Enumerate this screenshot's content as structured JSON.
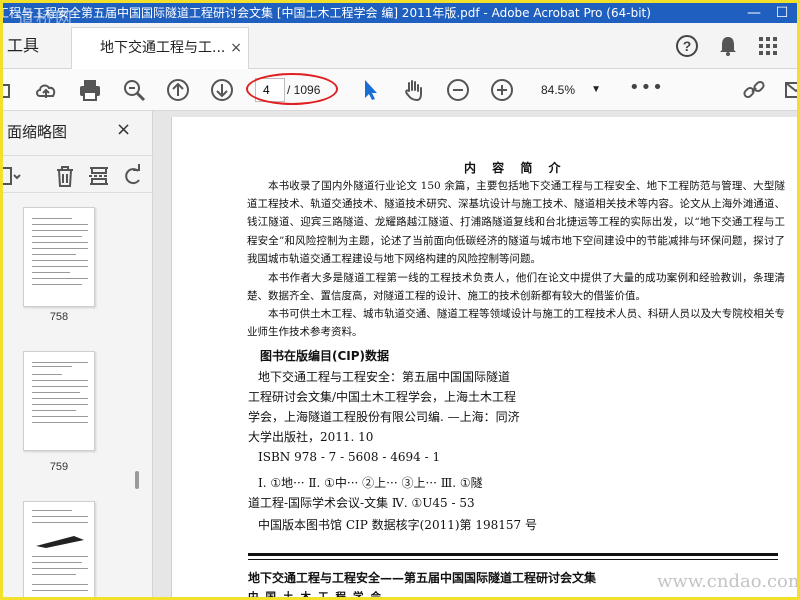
{
  "window": {
    "title": "工程与工程安全第五届中国国际隧道工程研讨会文集 [中国土木工程学会 编] 2011年版.pdf - Adobe Acrobat Pro (64-bit)",
    "watermark_top": "道桥网",
    "min_btn": "—",
    "max_btn": "☐"
  },
  "tabs": {
    "tools_label": "工具",
    "doc_tab_label": "地下交通工程与工...",
    "doc_tab_close": "×"
  },
  "toolbar": {
    "current_page": "4",
    "total_pages": "/ 1096",
    "zoom": "84.5%",
    "more": "•••"
  },
  "sidepanel": {
    "title": "面缩略图",
    "close": "×",
    "thumbnails": [
      "758",
      "759"
    ]
  },
  "page": {
    "heading": "内 容 简 介",
    "para1": "本书收录了国内外隧道行业论文 150 余篇，主要包括地下交通工程与工程安全、地下工程防范与管理、大型隧道工程技术、轨道交通技术、隧道技术研究、深基坑设计与施工技术、隧道相关技术等内容。论文从上海外滩通道、钱江隧道、迎宾三路隧道、龙耀路越江隧道、打浦路隧道复线和台北捷运等工程的实际出发，以“地下交通工程与工程安全”和风险控制为主题，论述了当前面向低碳经济的隧道与城市地下空间建设中的节能减排与环保问题，探讨了我国城市轨道交通工程建设与地下网络构建的风险控制等问题。",
    "para2": "本书作者大多是隧道工程第一线的工程技术负责人，他们在论文中提供了大量的成功案例和经验教训，条理清楚、数据齐全、置信度高，对隧道工程的设计、施工的技术创新都有较大的借鉴价值。",
    "para3": "本书可供土木工程、城市轨道交通、隧道工程等领域设计与施工的工程技术人员、科研人员以及大专院校相关专业师生作技术参考资料。",
    "cip_title": "图书在版编目(CIP)数据",
    "cip_lines": [
      "地下交通工程与工程安全：第五届中国国际隧道",
      "工程研讨会文集/中国土木工程学会，上海土木工程",
      "学会，上海隧道工程股份有限公司编. —上海：同济",
      "大学出版社，2011. 10",
      "ISBN 978 - 7 - 5608 - 4694 - 1"
    ],
    "class_lines": [
      "Ⅰ. ①地···  Ⅱ. ①中···  ②上···  ③上···   Ⅲ. ①隧",
      "道工程-国际学术会议-文集   Ⅳ. ①U45 - 53",
      "中国版本图书馆 CIP 数据核字(2011)第 198157 号"
    ],
    "footer_title": "地下交通工程与工程安全——第五届中国国际隧道工程研讨会文集",
    "footer_org": "中国土木工程学会"
  },
  "watermark_bottom": "www.cndao.com",
  "colors": {
    "titlebar": "#1f5fbf",
    "frame": "#f2e02a",
    "annotation_oval": "#e02020",
    "select_tool": "#1a6fd6"
  }
}
